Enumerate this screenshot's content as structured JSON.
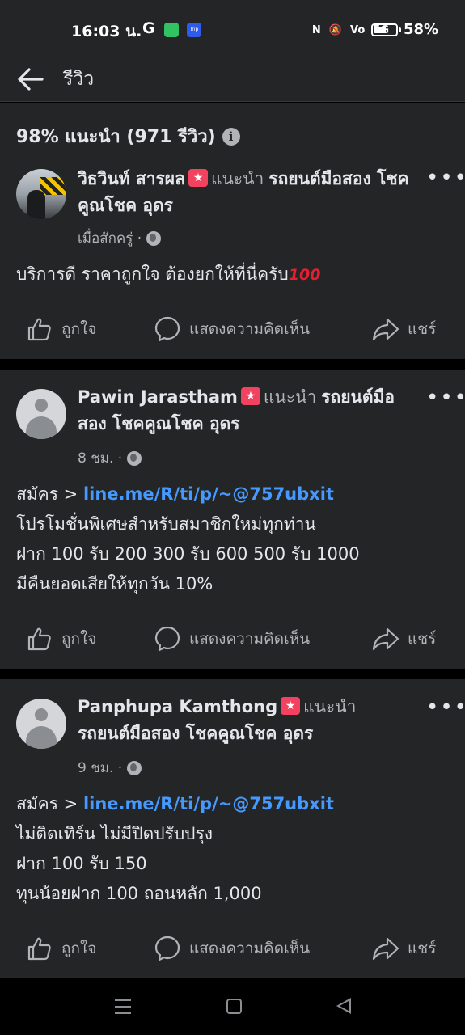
{
  "status_bar": {
    "time": "16:03 น.",
    "google_letter": "G",
    "trip_label": "Trip",
    "network": "5G",
    "battery_percent": "58%",
    "battery_level": 0.58
  },
  "nav": {
    "title": "รีวิว"
  },
  "summary": {
    "text": "98% แนะนำ (971 รีวิว)"
  },
  "reviews": [
    {
      "author": "วิธวินท์ สารผล",
      "recommend": "แนะนำ",
      "page": "รถยนต์มือสอง โชคคูณโชค อุดร",
      "time": "เมื่อสักครู่ ·",
      "lines": [
        "บริการดี ราคาถูกใจ ต้องยกให้ที่นี่ครับ"
      ],
      "emoji": "100"
    },
    {
      "author": "Pawin Jarastham",
      "recommend": "แนะนำ",
      "page": "รถยนต์มือสอง โชคคูณโชค อุดร",
      "time": "8 ชม. ·",
      "prefix": "สมัคร > ",
      "link": "line.me/R/ti/p/~@757ubxit",
      "lines": [
        "โปรโมชั่นพิเศษสำหรับสมาชิกใหม่ทุกท่าน",
        "ฝาก 100 รับ 200 300 รับ 600 500 รับ 1000",
        "มีคืนยอดเสียให้ทุกวัน 10%"
      ]
    },
    {
      "author": "Panphupa Kamthong",
      "recommend": "แนะนำ",
      "page": "รถยนต์มือสอง โชคคูณโชค อุดร",
      "time": "9 ชม. ·",
      "prefix": "สมัคร > ",
      "link": "line.me/R/ti/p/~@757ubxit",
      "lines": [
        "ไม่ติดเทิร์น ไม่มีปิดปรับปรุง",
        "ฝาก 100 รับ 150",
        "ทุนน้อยฝาก 100 ถอนหลัก 1,000"
      ]
    }
  ],
  "actions": {
    "like": "ถูกใจ",
    "comment": "แสดงความคิดเห็น",
    "share": "แชร์"
  },
  "colors": {
    "background": "#000000",
    "card": "#242526",
    "link": "#4599ff",
    "badge": "#f3425f"
  }
}
